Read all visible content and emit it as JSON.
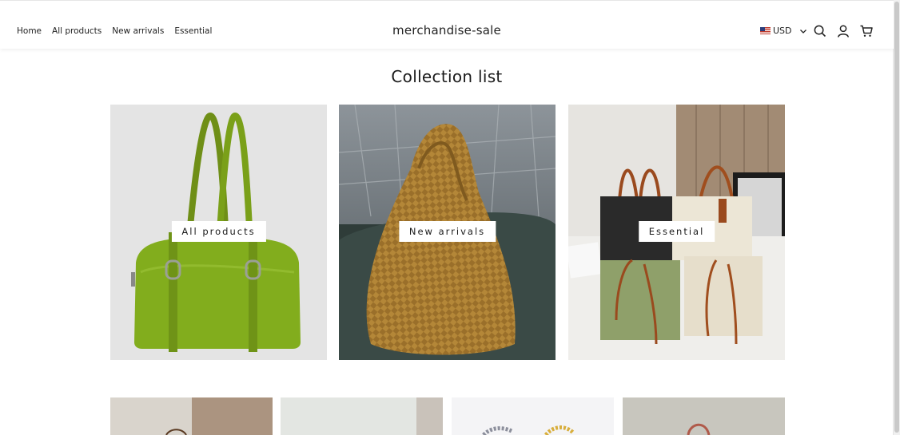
{
  "header": {
    "nav": [
      "Home",
      "All products",
      "New arrivals",
      "Essential"
    ],
    "brand": "merchandise-sale",
    "currency": "USD",
    "icons": [
      "us-flag-icon",
      "chevron-down-icon",
      "search-icon",
      "account-icon",
      "cart-icon"
    ]
  },
  "page_title": "Collection list",
  "collections": [
    {
      "label": "All products",
      "image": "green-leather-shoulder-bag"
    },
    {
      "label": "New arrivals",
      "image": "woven-brown-hobo-bag"
    },
    {
      "label": "Essential",
      "image": "canvas-tote-bags-group"
    }
  ],
  "product_thumbnails": [
    "tote-bag-thumbnail",
    "bag-thumbnail",
    "chain-bracelets-thumbnail",
    "handbag-thumbnail"
  ]
}
